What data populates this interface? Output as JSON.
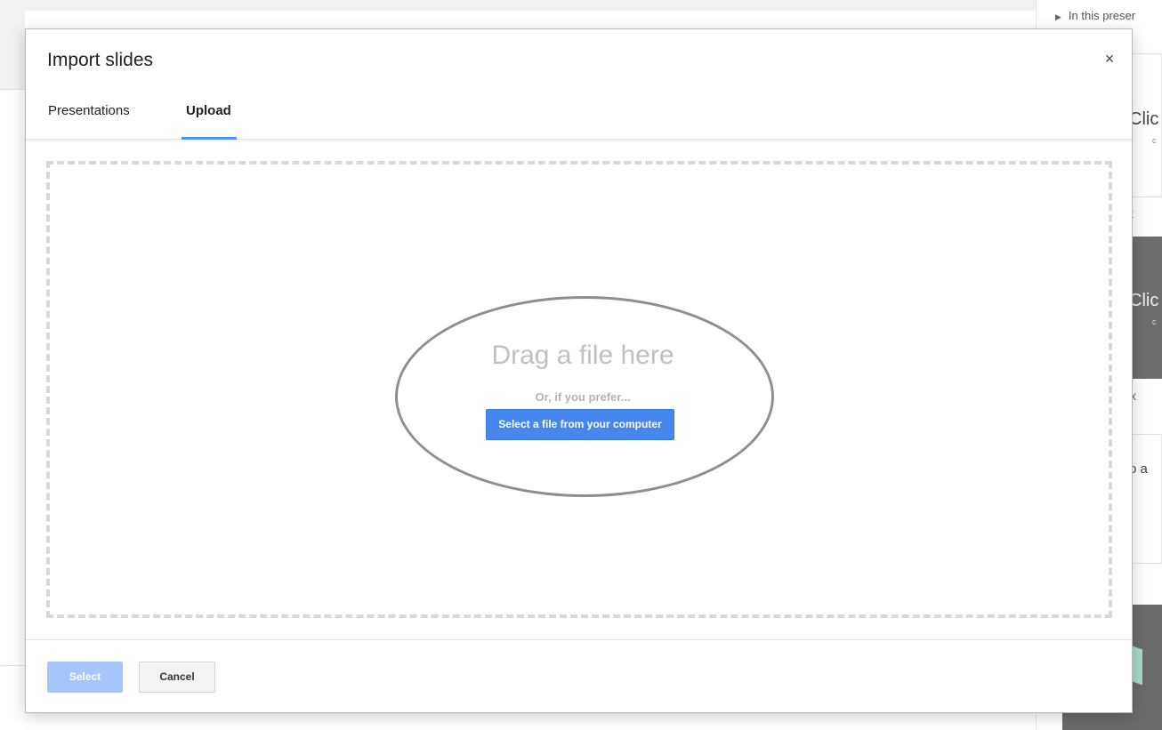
{
  "background": {
    "right_panel": {
      "header": "In this preser",
      "header_icon": "triangle-right-icon",
      "card1_big": "Clic",
      "card1_small": "c",
      "label1": "t",
      "card2_big": "Clic",
      "card2_small": "c",
      "label2": "x",
      "card3_text": "o a"
    }
  },
  "dialog": {
    "title": "Import slides",
    "close_icon": "×",
    "tabs": [
      {
        "label": "Presentations",
        "active": false
      },
      {
        "label": "Upload",
        "active": true
      }
    ],
    "upload": {
      "drag_text": "Drag a file here",
      "or_text": "Or, if you prefer...",
      "select_file_button": "Select a file from your computer"
    },
    "footer": {
      "select_label": "Select",
      "cancel_label": "Cancel"
    }
  },
  "colors": {
    "accent": "#4d90fe",
    "primary_button": "#4787ed",
    "disabled_button": "#a7c5fb"
  }
}
